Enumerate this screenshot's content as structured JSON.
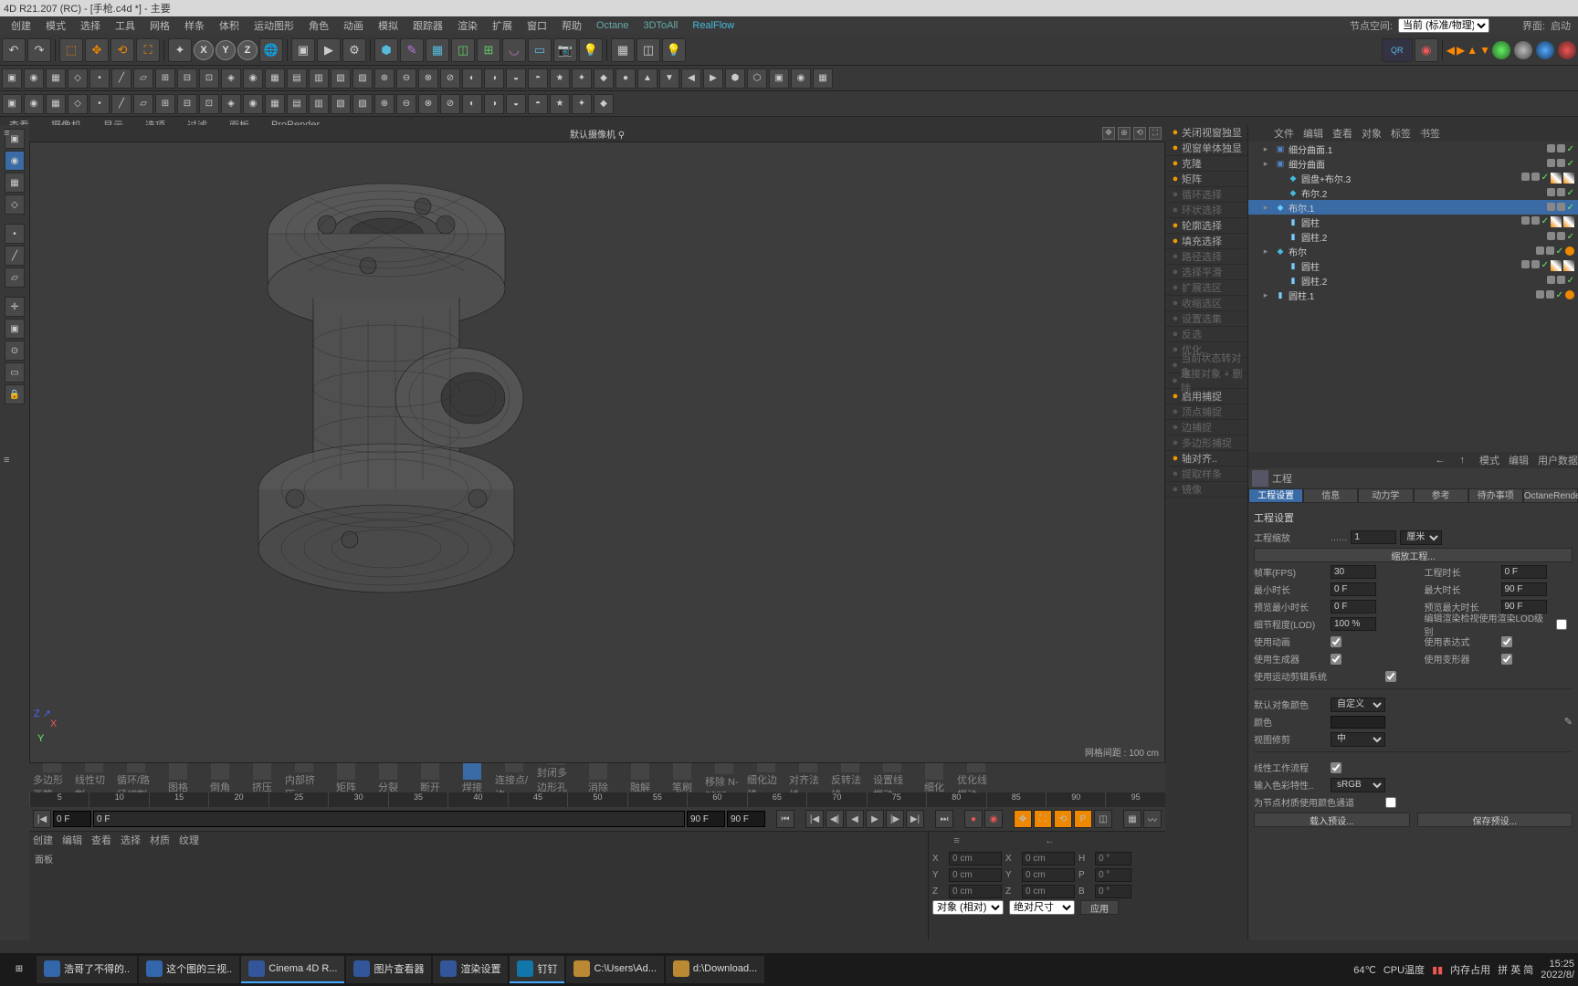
{
  "titlebar": "4D R21.207 (RC) - [手枪.c4d *] - 主要",
  "menu": [
    "创建",
    "模式",
    "选择",
    "工具",
    "网格",
    "样条",
    "体积",
    "运动图形",
    "角色",
    "动画",
    "模拟",
    "跟踪器",
    "渲染",
    "扩展",
    "窗口",
    "帮助",
    "Octane",
    "3DToAll",
    "RealFlow"
  ],
  "node_space": {
    "label": "节点空间:",
    "value": "当前 (标准/物理)"
  },
  "nav_right": {
    "label1": "界面:",
    "value1": "启动"
  },
  "viewmenu": [
    "查看",
    "摄像机",
    "显示",
    "选项",
    "过滤",
    "面板",
    "ProRender"
  ],
  "viewport": {
    "camera_label": "默认摄像机 ⚲",
    "grid_label": "网格间距 : 100 cm"
  },
  "right_tools": [
    {
      "t": "关闭视窗独显",
      "hl": true
    },
    {
      "t": "视窗单体独显"
    },
    {
      "t": "克隆"
    },
    {
      "t": "矩阵"
    },
    {
      "t": "循环选择",
      "dim": true
    },
    {
      "t": "环状选择",
      "dim": true
    },
    {
      "t": "轮廓选择"
    },
    {
      "t": "填充选择"
    },
    {
      "t": "路径选择",
      "dim": true
    },
    {
      "t": "选择平滑",
      "dim": true
    },
    {
      "t": "扩展选区",
      "dim": true
    },
    {
      "t": "收缩选区",
      "dim": true
    },
    {
      "t": "设置选集",
      "dim": true
    },
    {
      "t": "反选",
      "dim": true
    },
    {
      "t": "优化..",
      "dim": true
    },
    {
      "t": "当前状态转对象",
      "dim": true
    },
    {
      "t": "连接对象 + 删除",
      "dim": true
    },
    {
      "t": "启用捕捉"
    },
    {
      "t": "顶点捕捉",
      "dim": true
    },
    {
      "t": "边捕捉",
      "dim": true
    },
    {
      "t": "多边形捕捉",
      "dim": true
    },
    {
      "t": "轴对齐.."
    },
    {
      "t": "提取样条",
      "dim": true
    },
    {
      "t": "镜像",
      "dim": true
    }
  ],
  "obj_menu": [
    "文件",
    "编辑",
    "查看",
    "对象",
    "标签",
    "书签"
  ],
  "obj_tree": [
    {
      "depth": 0,
      "icon": "▣",
      "col": "#58c",
      "name": "细分曲面.1",
      "tags": [
        "g",
        "c"
      ]
    },
    {
      "depth": 0,
      "icon": "▣",
      "col": "#58c",
      "name": "细分曲面",
      "tags": [
        "g",
        "c"
      ]
    },
    {
      "depth": 1,
      "icon": "◆",
      "col": "#4bd",
      "name": "圆盘+布尔.3",
      "tags": [
        "g",
        "c",
        "t",
        "t"
      ]
    },
    {
      "depth": 1,
      "icon": "◆",
      "col": "#4bd",
      "name": "布尔.2",
      "tags": [
        "g",
        "c"
      ]
    },
    {
      "depth": 0,
      "icon": "◆",
      "col": "#6cf",
      "name": "布尔.1",
      "tags": [
        "g",
        "c"
      ],
      "sel": true
    },
    {
      "depth": 1,
      "icon": "▮",
      "col": "#7cf",
      "name": "圆柱",
      "tags": [
        "g",
        "c",
        "t",
        "t"
      ]
    },
    {
      "depth": 1,
      "icon": "▮",
      "col": "#7cf",
      "name": "圆柱.2",
      "tags": [
        "g",
        "c"
      ]
    },
    {
      "depth": 0,
      "icon": "◆",
      "col": "#4bd",
      "name": "布尔",
      "tags": [
        "g",
        "c",
        "o"
      ]
    },
    {
      "depth": 1,
      "icon": "▮",
      "col": "#7cf",
      "name": "圆柱",
      "tags": [
        "g",
        "c",
        "t",
        "t"
      ]
    },
    {
      "depth": 1,
      "icon": "▮",
      "col": "#7cf",
      "name": "圆柱.2",
      "tags": [
        "g",
        "c"
      ]
    },
    {
      "depth": 0,
      "icon": "▮",
      "col": "#7cf",
      "name": "圆柱.1",
      "tags": [
        "g",
        "c",
        "o"
      ]
    }
  ],
  "attr_menu": [
    "模式",
    "编辑",
    "用户数据"
  ],
  "attr_title": "工程",
  "attr_tabs": [
    "工程设置",
    "信息",
    "动力学",
    "参考",
    "待办事项",
    "OctaneRender"
  ],
  "attr": {
    "section_title": "工程设置",
    "scale_lbl": "工程缩放",
    "scale_val": "1",
    "scale_unit": "厘米",
    "scale_btn": "缩放工程...",
    "fps_lbl": "帧率(FPS)",
    "fps_val": "30",
    "projlen_lbl": "工程时长",
    "projlen_val": "0 F",
    "mintime_lbl": "最小时长",
    "mintime_val": "0 F",
    "maxtime_lbl": "最大时长",
    "maxtime_val": "90 F",
    "prevmin_lbl": "预览最小时长",
    "prevmin_val": "0 F",
    "prevmax_lbl": "预览最大时长",
    "prevmax_val": "90 F",
    "lod_lbl": "细节程度(LOD)",
    "lod_val": "100 %",
    "lod2_lbl": "编辑渲染检视使用渲染LOD级别",
    "anim_lbl": "使用动画",
    "expr_lbl": "使用表达式",
    "gen_lbl": "使用生成器",
    "def_lbl": "使用变形器",
    "mograph_lbl": "使用运动剪辑系统",
    "defcolor_lbl": "默认对象颜色",
    "defcolor_val": "自定义",
    "color_lbl": "颜色",
    "viewclip_lbl": "视图修剪",
    "viewclip_val": "中",
    "linear_lbl": "线性工作流程",
    "colorspace_lbl": "输入色彩特性..",
    "colorspace_val": "sRGB",
    "nodemat_lbl": "为节点材质使用颜色通道",
    "loadpreset": "载入预设...",
    "savepreset": "保存预设..."
  },
  "timeline_tools": [
    "多边形画笔",
    "线性切割",
    "循环/路径切割",
    "图格",
    "倒角",
    "挤压",
    "内部挤压",
    "矩阵",
    "分裂",
    "断开",
    "焊接",
    "连接点/边",
    "封闭多边形孔洞",
    "消除",
    "融解",
    "笔刷",
    "移除 N-gons",
    "细化边移",
    "对齐法线",
    "反转法线",
    "设置线框动",
    "细化",
    "优化线框动"
  ],
  "timeline_tools_highlight": 10,
  "timeline_ticks": [
    "5",
    "10",
    "15",
    "20",
    "25",
    "30",
    "35",
    "40",
    "45",
    "50",
    "55",
    "60",
    "65",
    "70",
    "75",
    "80",
    "85",
    "90",
    "95"
  ],
  "timeline": {
    "start": "0 F",
    "end": "90 F",
    "current": "0 F",
    "preview_end": "90 F"
  },
  "mat_menu": [
    "创建",
    "编辑",
    "查看",
    "选择",
    "材质",
    "纹理"
  ],
  "mat_tab": "面板",
  "coords": {
    "x_lbl": "X",
    "x_pos": "0 cm",
    "x_size": "0 cm",
    "h_lbl": "H",
    "h_val": "0 °",
    "y_lbl": "Y",
    "y_pos": "0 cm",
    "y_size": "0 cm",
    "p_lbl": "P",
    "p_val": "0 °",
    "z_lbl": "Z",
    "z_pos": "0 cm",
    "z_size": "0 cm",
    "b_lbl": "B",
    "b_val": "0 °",
    "obj_mode": "对象 (相对)",
    "size_mode": "绝对尺寸",
    "apply": "应用"
  },
  "taskbar": [
    {
      "t": "浩哥了不得的..",
      "c": "#36a"
    },
    {
      "t": "这个图的三视..",
      "c": "#36a"
    },
    {
      "t": "Cinema 4D R...",
      "c": "#359",
      "active": true
    },
    {
      "t": "图片查看器",
      "c": "#359"
    },
    {
      "t": "渲染设置",
      "c": "#359"
    },
    {
      "t": "钉钉",
      "c": "#17a",
      "active": true
    },
    {
      "t": "C:\\Users\\Ad...",
      "c": "#b83"
    },
    {
      "t": "d:\\Download...",
      "c": "#b83"
    }
  ],
  "tray": {
    "temp": "64℃",
    "cpu": "CPU温度",
    "mem": "内存占用",
    "ime": "拼 英 简",
    "time": "15:25",
    "date": "2022/8/"
  }
}
